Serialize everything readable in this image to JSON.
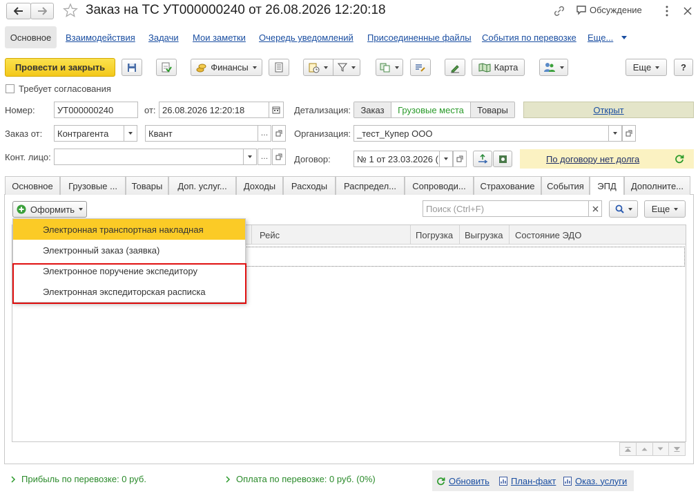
{
  "title": "Заказ на ТС УТ000000240 от 26.08.2026 12:20:18",
  "titlebar": {
    "discussion": "Обсуждение"
  },
  "nav": {
    "main": "Основное",
    "links": [
      "Взаимодействия",
      "Задачи",
      "Мои заметки",
      "Очередь уведомлений",
      "Присоединенные файлы",
      "События по перевозке",
      "Еще..."
    ]
  },
  "toolbar": {
    "post_close": "Провести и закрыть",
    "finance": "Финансы",
    "map": "Карта",
    "more": "Еще",
    "help": "?"
  },
  "form": {
    "requires_approval": "Требует согласования",
    "number_label": "Номер:",
    "number_value": "УТ000000240",
    "from_label": "от:",
    "date_value": "26.08.2026 12:20:18",
    "order_from_label": "Заказ от:",
    "order_from_value": "Контрагента",
    "counterparty_value": "Квант",
    "contact_label": "Конт. лицо:",
    "contact_value": "",
    "detail_label": "Детализация:",
    "detail_options": [
      "Заказ",
      "Грузовые места",
      "Товары"
    ],
    "status_value": "Открыт",
    "org_label": "Организация:",
    "org_value": "_тест_Купер ООО",
    "contract_label": "Договор:",
    "contract_value": "№ 1 от 23.03.2026 (",
    "debt_text": "По договору нет долга"
  },
  "tabs": [
    "Основное",
    "Грузовые ...",
    "Товары",
    "Доп. услуг...",
    "Доходы",
    "Расходы",
    "Распредел...",
    "Сопроводи...",
    "Страхование",
    "События",
    "ЭПД",
    "Дополните..."
  ],
  "epd": {
    "create_btn": "Оформить",
    "search_placeholder": "Поиск (Ctrl+F)",
    "more": "Еще",
    "columns": [
      "Рейс",
      "Погрузка",
      "Выгрузка",
      "Состояние ЭДО"
    ],
    "menu": [
      "Электронная транспортная накладная",
      "Электронный заказ (заявка)",
      "Электронное поручение экспедитору",
      "Электронная экспедиторская расписка"
    ]
  },
  "footer": {
    "profit": "Прибыль по перевозке: 0 руб.",
    "payment": "Оплата по перевозке: 0 руб. (0%)",
    "refresh": "Обновить",
    "plan_fact": "План-факт",
    "services": "Оказ. услуги"
  },
  "colors": {
    "accent_yellow": "#f5d328",
    "status_bg": "#e4e5c9",
    "debt_bg": "#fbf2c2",
    "highlight_red": "#e01010",
    "green": "#2a9a2a"
  }
}
